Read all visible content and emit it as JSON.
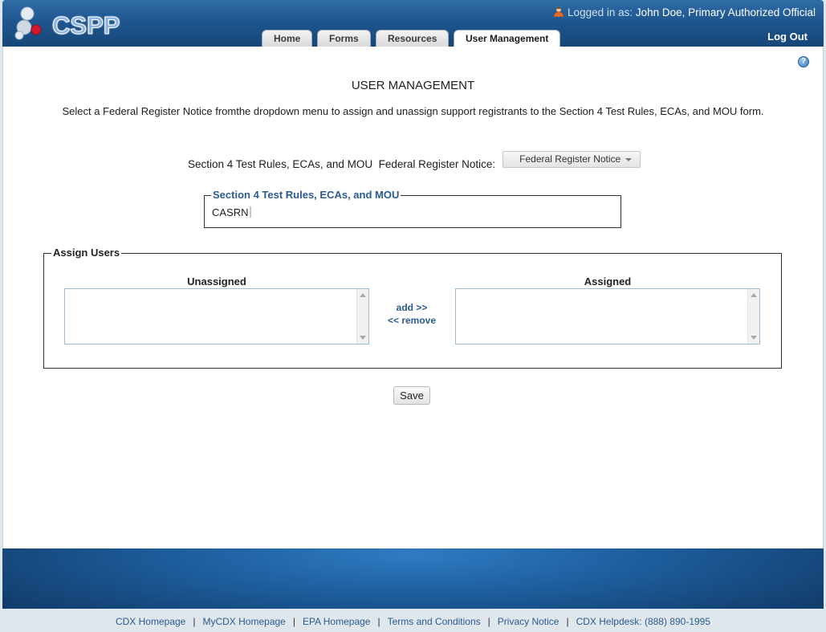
{
  "header": {
    "logo_text": "CSPP",
    "logged_in_label": "Logged in as:",
    "user_name": "John Doe, Primary Authorized Official",
    "logout_label": "Log Out",
    "tabs": [
      {
        "label": "Home",
        "active": false
      },
      {
        "label": "Forms",
        "active": false
      },
      {
        "label": "Resources",
        "active": false
      },
      {
        "label": "User Management",
        "active": true
      }
    ]
  },
  "main": {
    "title": "USER MANAGEMENT",
    "instructions": "Select a Federal Register Notice fromthe dropdown menu to assign and unassign support registrants to the Section 4 Test Rules, ECAs, and MOU form.",
    "frn_label": "Section 4 Test Rules, ECAs, and MOU  Federal Register Notice:",
    "frn_select_value": "Federal Register Notice",
    "section_legend": "Section 4 Test Rules, ECAs, and MOU",
    "casrn_label": "CASRN",
    "assign_legend": "Assign Users",
    "unassigned_title": "Unassigned",
    "assigned_title": "Assigned",
    "add_label": "add >>",
    "remove_label": "<< remove",
    "save_label": "Save"
  },
  "footer": {
    "links": [
      "CDX Homepage",
      "MyCDX Homepage",
      "EPA Homepage",
      "Terms and Conditions",
      "Privacy Notice",
      "CDX Helpdesk: (888) 890-1995"
    ]
  },
  "colors": {
    "header_blue": "#1f5690",
    "link_blue": "#2a5c91",
    "page_background": "#ffffff"
  }
}
